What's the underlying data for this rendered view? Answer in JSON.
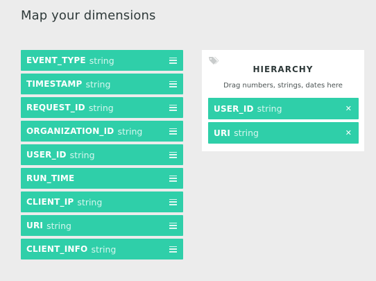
{
  "page": {
    "title": "Map your dimensions"
  },
  "dimensions": [
    {
      "name": "EVENT_TYPE",
      "type": "string"
    },
    {
      "name": "TIMESTAMP",
      "type": "string"
    },
    {
      "name": "REQUEST_ID",
      "type": "string"
    },
    {
      "name": "ORGANIZATION_ID",
      "type": "string"
    },
    {
      "name": "USER_ID",
      "type": "string"
    },
    {
      "name": "RUN_TIME",
      "type": ""
    },
    {
      "name": "CLIENT_IP",
      "type": "string"
    },
    {
      "name": "URI",
      "type": "string"
    },
    {
      "name": "CLIENT_INFO",
      "type": "string"
    }
  ],
  "hierarchy": {
    "title": "HIERARCHY",
    "hint": "Drag numbers, strings, dates here",
    "icon": "tag-icon",
    "items": [
      {
        "name": "USER_ID",
        "type": "string",
        "remove_label": "✕"
      },
      {
        "name": "URI",
        "type": "string",
        "remove_label": "✕"
      }
    ]
  },
  "colors": {
    "pill": "#2fcfa9",
    "background": "#ececec",
    "panel": "#ffffff"
  }
}
